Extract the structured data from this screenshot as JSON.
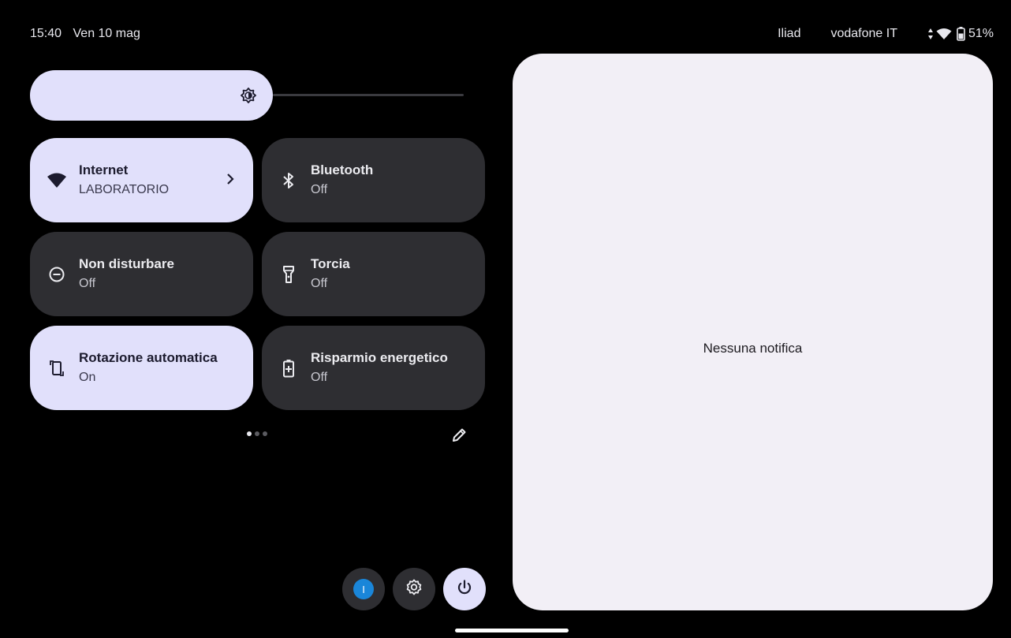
{
  "status_bar": {
    "time": "15:40",
    "date": "Ven 10 mag",
    "carriers": [
      "Iliad",
      "vodafone IT"
    ],
    "battery": "51%"
  },
  "brightness": {
    "level": 0.56
  },
  "tiles": [
    {
      "label": "Internet",
      "state": "LABORATORIO",
      "icon": "wifi-icon",
      "active": true,
      "has_chevron": true
    },
    {
      "label": "Bluetooth",
      "state": "Off",
      "icon": "bluetooth-icon",
      "active": false
    },
    {
      "label": "Non disturbare",
      "state": "Off",
      "icon": "do-not-disturb-icon",
      "active": false
    },
    {
      "label": "Torcia",
      "state": "Off",
      "icon": "flashlight-icon",
      "active": false
    },
    {
      "label": "Rotazione automatica",
      "state": "On",
      "icon": "auto-rotate-icon",
      "active": true
    },
    {
      "label": "Risparmio energetico",
      "state": "Off",
      "icon": "battery-saver-icon",
      "active": false
    }
  ],
  "pager": {
    "pages": 3,
    "current": 1
  },
  "footer": {
    "user_initial": "I"
  },
  "notifications": {
    "empty_text": "Nessuna notifica"
  },
  "colors": {
    "tile_on": "#e1e0fb",
    "tile_off": "#2e2e32",
    "panel": "#f2eff6",
    "avatar": "#1a86d9"
  }
}
